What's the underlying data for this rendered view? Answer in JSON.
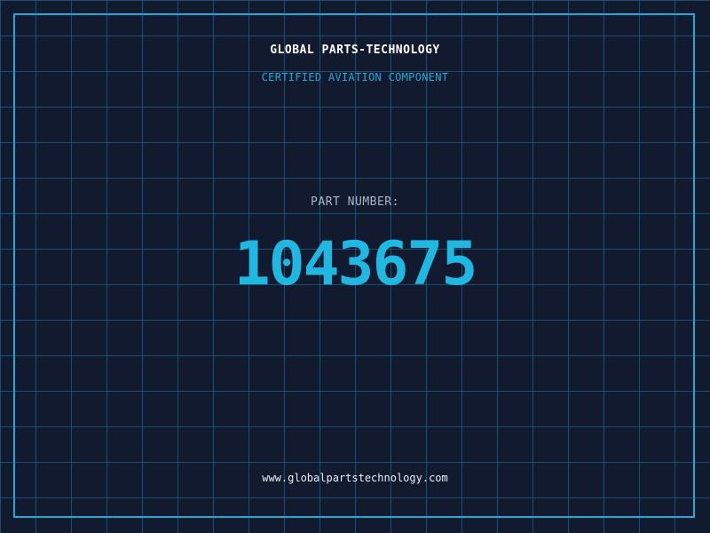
{
  "header": {
    "company": "GLOBAL PARTS-TECHNOLOGY",
    "tagline": "CERTIFIED AVIATION COMPONENT"
  },
  "part": {
    "label": "PART NUMBER:",
    "number": "1043675"
  },
  "footer": {
    "website": "www.globalpartstechnology.com"
  },
  "colors": {
    "background": "#111a2e",
    "grid": "#287890",
    "accent": "#1fa9d6",
    "number": "#1fb8e3"
  }
}
